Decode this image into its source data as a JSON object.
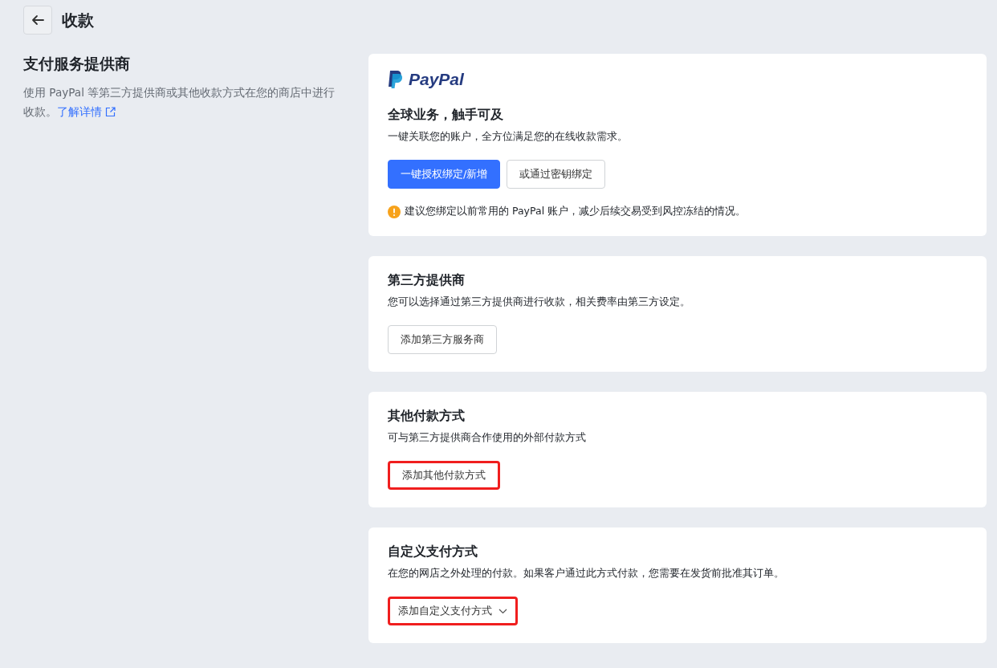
{
  "header": {
    "title": "收款"
  },
  "intro": {
    "title": "支付服务提供商",
    "description": "使用 PayPal 等第三方提供商或其他收款方式在您的商店中进行收款。",
    "link": "了解详情"
  },
  "cards": [
    {
      "kind": "paypal",
      "logo_text": "PayPal",
      "title": "全球业务，触手可及",
      "description": "一键关联您的账户，全方位满足您的在线收款需求。",
      "buttons": [
        {
          "label": "一键授权绑定/新增",
          "kind": "primary",
          "highlighted": false,
          "dropdown": false
        },
        {
          "label": "或通过密钥绑定",
          "kind": "default",
          "highlighted": false,
          "dropdown": false
        }
      ],
      "notice": "建议您绑定以前常用的 PayPal 账户，减少后续交易受到风控冻结的情况。"
    },
    {
      "kind": "plain",
      "title": "第三方提供商",
      "description": "您可以选择通过第三方提供商进行收款，相关费率由第三方设定。",
      "buttons": [
        {
          "label": "添加第三方服务商",
          "kind": "default",
          "highlighted": false,
          "dropdown": false
        }
      ]
    },
    {
      "kind": "plain",
      "title": "其他付款方式",
      "description": "可与第三方提供商合作使用的外部付款方式",
      "buttons": [
        {
          "label": "添加其他付款方式",
          "kind": "default",
          "highlighted": true,
          "dropdown": false
        }
      ]
    },
    {
      "kind": "plain",
      "title": "自定义支付方式",
      "description": "在您的网店之外处理的付款。如果客户通过此方式付款，您需要在发货前批准其订单。",
      "buttons": [
        {
          "label": "添加自定义支付方式",
          "kind": "text",
          "highlighted": true,
          "dropdown": true
        }
      ]
    }
  ]
}
